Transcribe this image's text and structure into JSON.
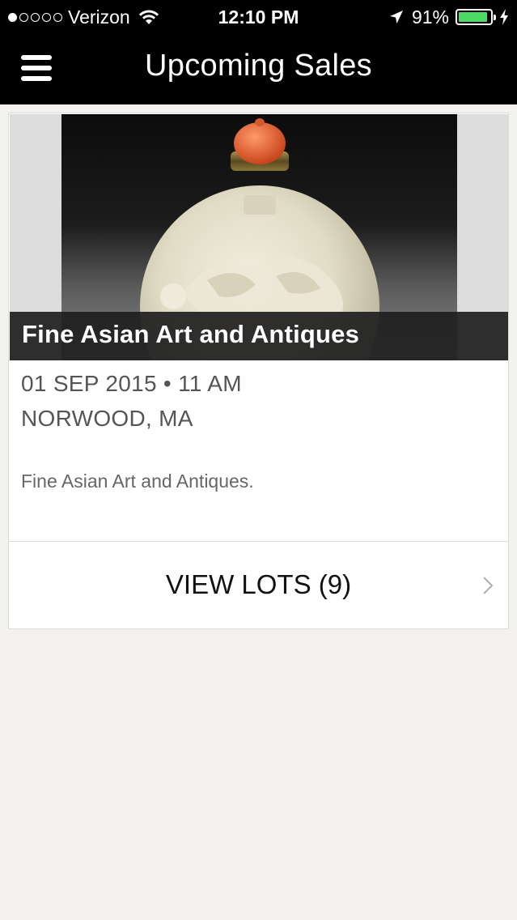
{
  "status_bar": {
    "carrier": "Verizon",
    "signal_bars_filled": 1,
    "signal_bars_total": 5,
    "time": "12:10 PM",
    "battery_percent": "91%",
    "battery_level": 0.91,
    "battery_color": "#4cd964"
  },
  "nav": {
    "title": "Upcoming Sales",
    "menu_icon": "hamburger-menu-icon"
  },
  "sale": {
    "title": "Fine Asian Art and Antiques",
    "date_time": "01 SEP 2015 • 11 AM",
    "location": "NORWOOD, MA",
    "description": "Fine Asian Art and Antiques.",
    "view_lots_label": "VIEW LOTS (9)",
    "chevron_icon": "chevron-right-icon"
  }
}
